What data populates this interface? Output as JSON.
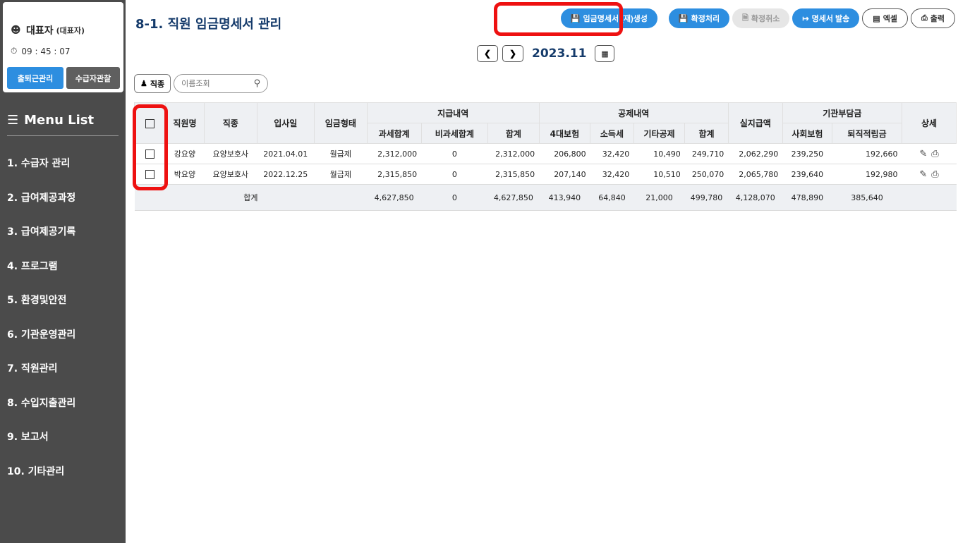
{
  "user": {
    "name": "대표자",
    "role": "(대표자)",
    "time": "09 : 45 : 07"
  },
  "side_buttons": {
    "attendance": "출퇴근관리",
    "recipient_watch": "수급자관찰"
  },
  "menu": {
    "title": "Menu List",
    "items": [
      "1. 수급자 관리",
      "2. 급여제공과정",
      "3. 급여제공기록",
      "4. 프로그램",
      "5. 환경및안전",
      "6. 기관운영관리",
      "7. 직원관리",
      "8. 수입지출관리",
      "9. 보고서",
      "10. 기타관리"
    ]
  },
  "page_title": "8-1. 직원 임금명세서 관리",
  "toolbar": {
    "regenerate": "임금명세서 (재)생성",
    "confirm": "확정처리",
    "cancel_confirm": "확정취소",
    "send": "명세서 발송",
    "excel": "엑셀",
    "print": "출력"
  },
  "month": "2023.11",
  "filter": {
    "job_label": "직종",
    "search_placeholder": "이름조회"
  },
  "table": {
    "headers": {
      "name": "직원명",
      "job": "직종",
      "hire_date": "입사일",
      "wage_type": "임금형태",
      "payment": "지급내역",
      "taxable": "과세합계",
      "nontaxable": "비과세합계",
      "pay_total": "합계",
      "deduction": "공제내역",
      "insurance": "4대보험",
      "income_tax": "소득세",
      "other_deduction": "기타공제",
      "ded_total": "합계",
      "net_pay": "실지급액",
      "institution": "기관부담금",
      "social_ins": "사회보험",
      "retirement": "퇴직적립금",
      "detail": "상세"
    },
    "rows": [
      {
        "name": "강요양",
        "job": "요양보호사",
        "hire_date": "2021.04.01",
        "wage_type": "월급제",
        "taxable": "2,312,000",
        "nontaxable": "0",
        "pay_total": "2,312,000",
        "insurance": "206,800",
        "income_tax": "32,420",
        "other_deduction": "10,490",
        "ded_total": "249,710",
        "net_pay": "2,062,290",
        "social_ins": "239,250",
        "retirement": "192,660"
      },
      {
        "name": "박요양",
        "job": "요양보호사",
        "hire_date": "2022.12.25",
        "wage_type": "월급제",
        "taxable": "2,315,850",
        "nontaxable": "0",
        "pay_total": "2,315,850",
        "insurance": "207,140",
        "income_tax": "32,420",
        "other_deduction": "10,510",
        "ded_total": "250,070",
        "net_pay": "2,065,780",
        "social_ins": "239,640",
        "retirement": "192,980"
      }
    ],
    "sum": {
      "label": "합계",
      "taxable": "4,627,850",
      "nontaxable": "0",
      "pay_total": "4,627,850",
      "insurance": "413,940",
      "income_tax": "64,840",
      "other_deduction": "21,000",
      "ded_total": "499,780",
      "net_pay": "4,128,070",
      "social_ins": "478,890",
      "retirement": "385,640"
    }
  },
  "colors": {
    "sidebar": "#4b4b4b",
    "primary": "#2d8ee0",
    "title": "#153b6b",
    "highlight": "#ee1111"
  }
}
